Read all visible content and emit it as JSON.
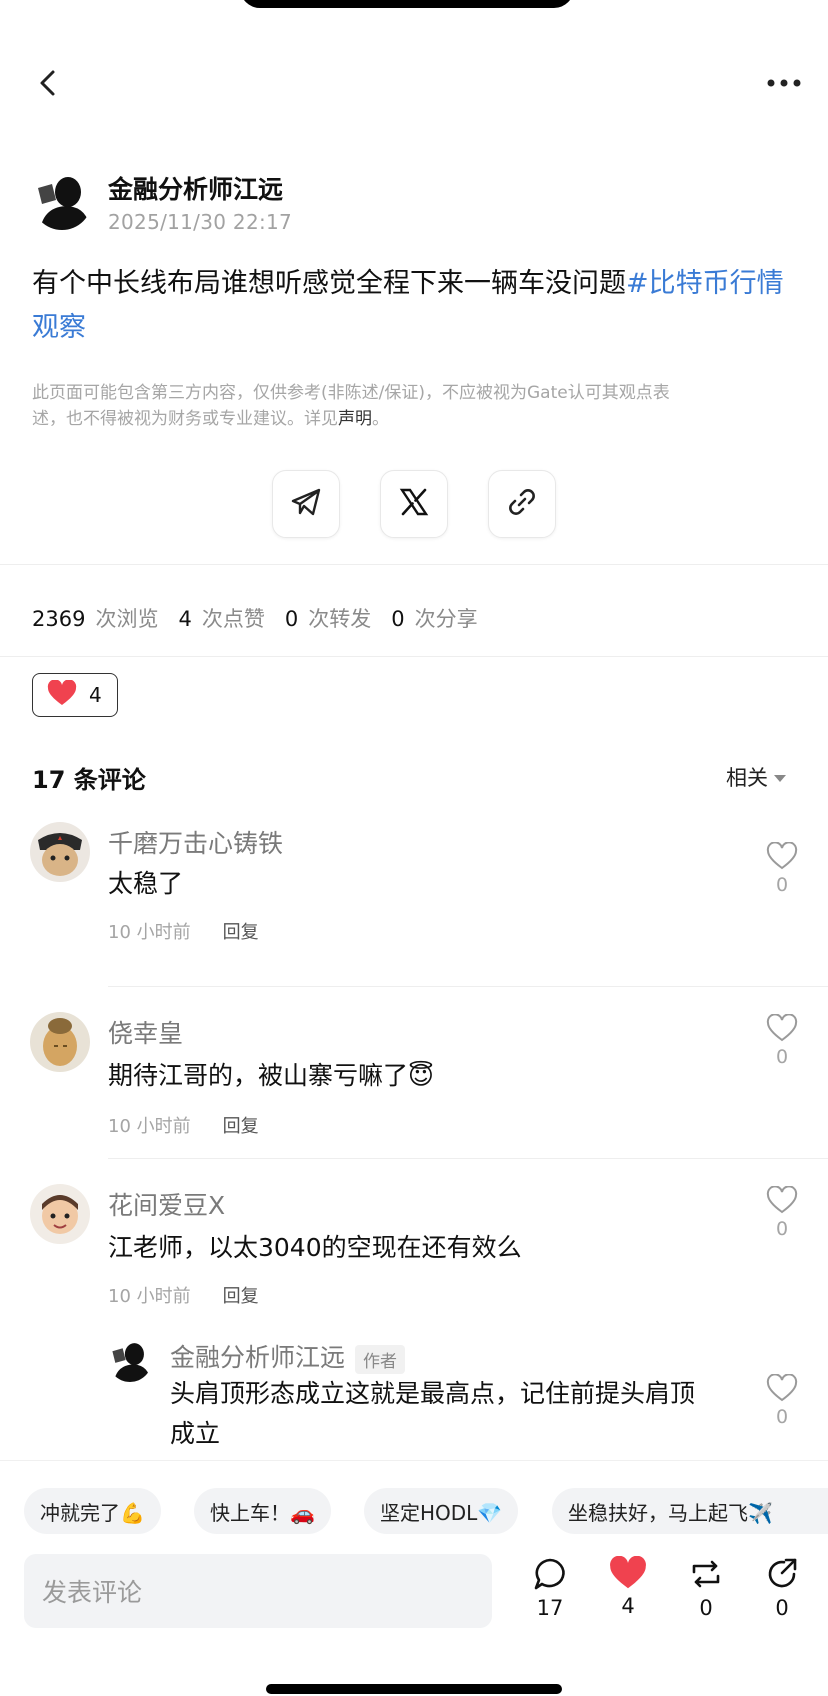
{
  "nav": {
    "back_icon": "chevron-left-icon",
    "more_icon": "more-horizontal-icon"
  },
  "post": {
    "author": "金融分析师江远",
    "time": "2025/11/30 22:17",
    "text": "有个中长线布局谁想听感觉全程下来一辆车没问题",
    "topic": "#比特币行情观察",
    "disclaimer_line1": "此页面可能包含第三方内容，仅供参考(非陈述/保证)，不应被视为Gate认可其观点表",
    "disclaimer_line2": "述，也不得被视为财务或专业建议。详见",
    "disclaimer_link": "声明",
    "disclaimer_end": "。"
  },
  "share": {
    "icons": [
      "telegram-icon",
      "x-icon",
      "link-icon"
    ]
  },
  "stats": {
    "views": "2369",
    "views_label": "次浏览",
    "likes": "4",
    "likes_label": "次点赞",
    "reposts": "0",
    "reposts_label": "次转发",
    "shares": "0",
    "shares_label": "次分享"
  },
  "reaction": {
    "count": "4",
    "icon": "heart-icon",
    "color": "#f0424f"
  },
  "comments": {
    "title": "17 条评论",
    "sort": "相关",
    "items": [
      {
        "name": "千磨万击心铸铁",
        "text": "太稳了",
        "time": "10 小时前",
        "reply": "回复",
        "likes": "0"
      },
      {
        "name": "侥幸皇",
        "text": "期待江哥的，被山寨亏嘛了😇",
        "time": "10 小时前",
        "reply": "回复",
        "likes": "0"
      },
      {
        "name": "花间爱豆X",
        "text": "江老师，以太3040的空现在还有效么",
        "time": "10 小时前",
        "reply": "回复",
        "likes": "0"
      }
    ],
    "reply": {
      "name": "金融分析师江远",
      "tag": "作者",
      "text_line1": "头肩顶形态成立这就是最高点，记住前提头肩顶",
      "text_line2": "成立",
      "likes": "0"
    }
  },
  "quick_replies": [
    "冲就完了💪",
    "快上车！🚗",
    "坚定HODL💎",
    "坐稳扶好，马上起飞✈️"
  ],
  "composer": {
    "placeholder": "发表评论"
  },
  "actions": {
    "comments": "17",
    "likes": "4",
    "reposts": "0",
    "shares": "0"
  },
  "colors": {
    "accent_link": "#3a7bd5",
    "heart": "#f0424f"
  }
}
